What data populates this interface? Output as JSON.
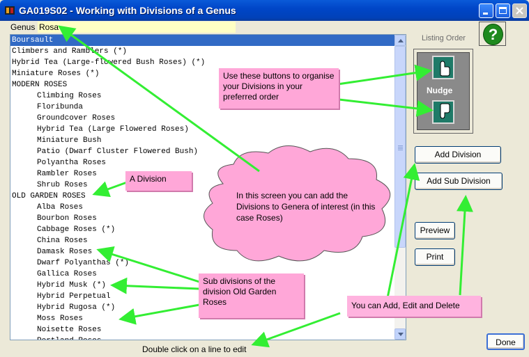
{
  "window": {
    "title": "GA019S02 - Working with Divisions of a Genus"
  },
  "genus": {
    "label": "Genus",
    "value": "Rosa"
  },
  "list": {
    "selected_index": 0,
    "rows": [
      {
        "text": "Boursault",
        "indent": 0
      },
      {
        "text": "Climbers and Ramblers (*)",
        "indent": 0
      },
      {
        "text": "Hybrid Tea (Large-flowered Bush Roses) (*)",
        "indent": 0
      },
      {
        "text": "Miniature Roses (*)",
        "indent": 0
      },
      {
        "text": "MODERN ROSES",
        "indent": 0
      },
      {
        "text": "Climbing Roses",
        "indent": 1
      },
      {
        "text": "Floribunda",
        "indent": 1
      },
      {
        "text": "Groundcover Roses",
        "indent": 1
      },
      {
        "text": "Hybrid Tea (Large Flowered Roses)",
        "indent": 1
      },
      {
        "text": "Miniature Bush",
        "indent": 1
      },
      {
        "text": "Patio (Dwarf Cluster Flowered Bush)",
        "indent": 1
      },
      {
        "text": "Polyantha Roses",
        "indent": 1
      },
      {
        "text": "Rambler Roses",
        "indent": 1
      },
      {
        "text": "Shrub Roses",
        "indent": 1
      },
      {
        "text": "OLD GARDEN ROSES",
        "indent": 0
      },
      {
        "text": "Alba Roses",
        "indent": 1
      },
      {
        "text": "Bourbon Roses",
        "indent": 1
      },
      {
        "text": "Cabbage Roses (*)",
        "indent": 1
      },
      {
        "text": "China Roses",
        "indent": 1
      },
      {
        "text": "Damask Roses",
        "indent": 1
      },
      {
        "text": "Dwarf Polyanthas (*)",
        "indent": 1
      },
      {
        "text": "Gallica Roses",
        "indent": 1
      },
      {
        "text": "Hybrid Musk (*)",
        "indent": 1
      },
      {
        "text": "Hybrid Perpetual",
        "indent": 1
      },
      {
        "text": "Hybrid Rugosa (*)",
        "indent": 1
      },
      {
        "text": "Moss Roses",
        "indent": 1
      },
      {
        "text": "Noisette Roses",
        "indent": 1
      },
      {
        "text": "Portland Roses",
        "indent": 1
      }
    ]
  },
  "status": {
    "hint": "Double click on a line to edit"
  },
  "right_panel": {
    "listing_order_label": "Listing Order",
    "nudge_label": "Nudge",
    "help_label": "?",
    "add_division": "Add Division",
    "add_sub_division": "Add Sub Division",
    "preview": "Preview",
    "print": "Print",
    "done": "Done"
  },
  "annotations": {
    "nudge_note": "Use these buttons to organise your Divisions in your preferred order",
    "division_note": "A Division",
    "cloud_note": "In this screen you can add the Divisions to Genera of interest (in this case Roses)",
    "sub_note": "Sub divisions of the division Old Garden Roses",
    "add_note": "You can Add, Edit and Delete"
  },
  "colors": {
    "note_pink": "#ffa7d8",
    "arrow_green": "#33ee33",
    "selection_blue": "#316ac5",
    "genus_field_yellow": "#ffffc4"
  }
}
